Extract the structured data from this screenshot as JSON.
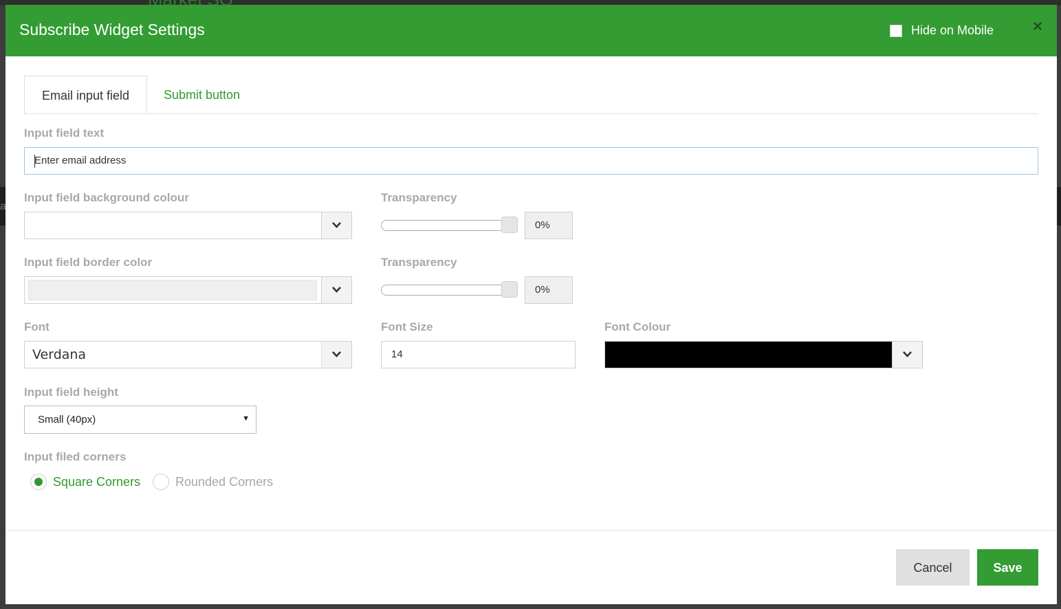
{
  "background": {
    "title": "Market SO",
    "edge_letter": "a"
  },
  "dialog": {
    "title": "Subscribe Widget Settings",
    "hide_on_mobile_label": "Hide on Mobile",
    "hide_on_mobile_checked": false,
    "close_glyph": "×"
  },
  "tabs": [
    {
      "label": "Email input field",
      "active": true
    },
    {
      "label": "Submit button",
      "active": false
    }
  ],
  "form": {
    "input_text_label": "Input field text",
    "input_text_value": "Enter email address",
    "bg_colour_label": "Input field background colour",
    "bg_colour_value": "#ffffff",
    "bg_transparency_label": "Transparency",
    "bg_transparency_value": "0%",
    "border_color_label": "Input field border color",
    "border_color_value": "#efefef",
    "border_transparency_label": "Transparency",
    "border_transparency_value": "0%",
    "font_label": "Font",
    "font_value": "Verdana",
    "font_size_label": "Font Size",
    "font_size_value": "14",
    "font_colour_label": "Font Colour",
    "font_colour_value": "#000000",
    "height_label": "Input field height",
    "height_value": "Small (40px)",
    "corners_label": "Input filed corners",
    "corners_options": [
      {
        "label": "Square Corners",
        "checked": true
      },
      {
        "label": "Rounded Corners",
        "checked": false
      }
    ]
  },
  "footer": {
    "cancel_label": "Cancel",
    "save_label": "Save"
  },
  "colors": {
    "accent": "#339c33",
    "accent_text": "#2f9a2f",
    "label_grey": "#a8a8a8"
  },
  "icons": {
    "close": "close-icon",
    "dropdown": "chevron-down-icon",
    "select_arrow": "triangle-down-icon"
  }
}
